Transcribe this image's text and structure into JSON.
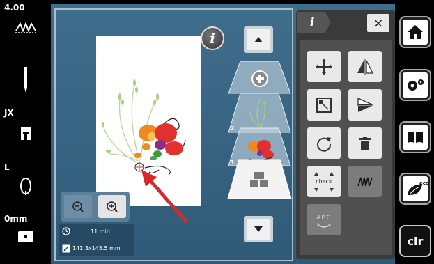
{
  "left_bar": {
    "stitch_width": "4.00",
    "presser_foot": "JX",
    "tension_label": "L",
    "stitch_length": "0mm"
  },
  "zoom": {
    "zoom_out_icon": "zoom-out-icon",
    "zoom_in_icon": "zoom-in-icon"
  },
  "info": {
    "time": "11 min.",
    "size": "141.3x145.5 mm"
  },
  "layers": {
    "layer2_number": "2",
    "layer1_number": "1"
  },
  "tool_panel": {
    "header_icon": "info-icon",
    "close_label": "×",
    "check_label": "check",
    "abc_label": "ABC"
  },
  "right_bar": {
    "clr_label": "clr",
    "eco_label": "eco"
  },
  "colors": {
    "screen_bg": "#3f6e8c",
    "panel_bg": "#3a3a3a",
    "arrow_red": "#d42a2a",
    "flower_red": "#e0312e",
    "flower_orange": "#f08a1c",
    "leaf_green": "#9ccc6a"
  }
}
